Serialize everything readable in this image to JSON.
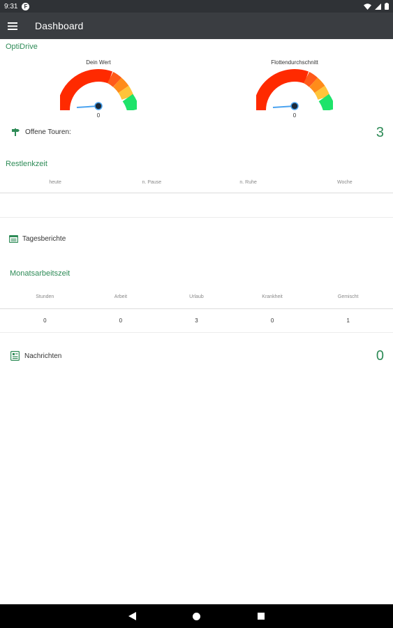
{
  "status_bar": {
    "time": "9:31",
    "notification_icon": "F"
  },
  "app_bar": {
    "title": "Dashboard",
    "menu_icon": "hamburger-menu-icon"
  },
  "optidrive": {
    "title": "OptiDrive",
    "gauges": [
      {
        "label": "Dein Wert",
        "value": "0",
        "level": 0
      },
      {
        "label": "Flottendurchschnitt",
        "value": "0",
        "level": 0
      }
    ],
    "colors": [
      "#ff2a00",
      "#ff4a1a",
      "#ff7a1a",
      "#ffc23a",
      "#7be36a",
      "#1ee36a"
    ]
  },
  "offene_touren": {
    "label": "Offene Touren:",
    "value": "3"
  },
  "restlenkzeit": {
    "title": "Restlenkzeit",
    "columns": [
      "heute",
      "n. Pause",
      "n. Ruhe",
      "Woche"
    ]
  },
  "tagesberichte": {
    "label": "Tagesberichte"
  },
  "monatsarbeitszeit": {
    "title": "Monatsarbeitszeit",
    "columns": [
      "Stunden",
      "Arbeit",
      "Urlaub",
      "Krankheit",
      "Gemischt"
    ],
    "values": [
      "0",
      "0",
      "3",
      "0",
      "1"
    ]
  },
  "nachrichten": {
    "label": "Nachrichten",
    "value": "0"
  }
}
